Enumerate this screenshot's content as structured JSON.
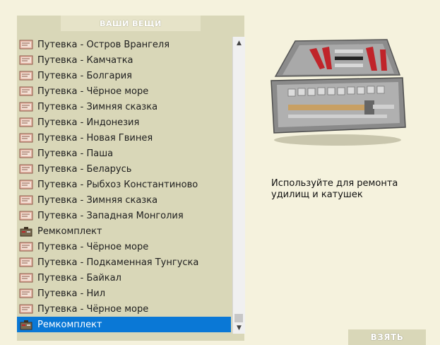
{
  "panel": {
    "title": "ВАШИ ВЕЩИ"
  },
  "items": [
    {
      "label": "Путевка - Остров Врангеля",
      "icon": "ticket-icon",
      "selected": false
    },
    {
      "label": "Путевка - Камчатка",
      "icon": "ticket-icon",
      "selected": false
    },
    {
      "label": "Путевка - Болгария",
      "icon": "ticket-icon",
      "selected": false
    },
    {
      "label": "Путевка - Чёрное море",
      "icon": "ticket-icon",
      "selected": false
    },
    {
      "label": "Путевка - Зимняя сказка",
      "icon": "ticket-icon",
      "selected": false
    },
    {
      "label": "Путевка - Индонезия",
      "icon": "ticket-icon",
      "selected": false
    },
    {
      "label": "Путевка - Новая Гвинея",
      "icon": "ticket-icon",
      "selected": false
    },
    {
      "label": "Путевка - Паша",
      "icon": "ticket-icon",
      "selected": false
    },
    {
      "label": "Путевка - Беларусь",
      "icon": "ticket-icon",
      "selected": false
    },
    {
      "label": "Путевка - Рыбхоз Константиново",
      "icon": "ticket-icon",
      "selected": false
    },
    {
      "label": "Путевка - Зимняя сказка",
      "icon": "ticket-icon",
      "selected": false
    },
    {
      "label": "Путевка - Западная Монголия",
      "icon": "ticket-icon",
      "selected": false
    },
    {
      "label": "Ремкомплект",
      "icon": "repair-kit-icon",
      "selected": false
    },
    {
      "label": "Путевка - Чёрное море",
      "icon": "ticket-icon",
      "selected": false
    },
    {
      "label": "Путевка - Подкаменная Тунгуска",
      "icon": "ticket-icon",
      "selected": false
    },
    {
      "label": "Путевка - Байкал",
      "icon": "ticket-icon",
      "selected": false
    },
    {
      "label": "Путевка - Нил",
      "icon": "ticket-icon",
      "selected": false
    },
    {
      "label": "Путевка - Чёрное море",
      "icon": "ticket-icon",
      "selected": false
    },
    {
      "label": "Ремкомплект",
      "icon": "repair-kit-icon",
      "selected": true
    }
  ],
  "details": {
    "image": "toolbox-image",
    "description": "Используйте для ремонта удилищ и катушек"
  },
  "actions": {
    "take_label": "ВЗЯТЬ"
  },
  "colors": {
    "background": "#f5f2dd",
    "panel": "#d9d7b8",
    "selection": "#0a78d6"
  }
}
